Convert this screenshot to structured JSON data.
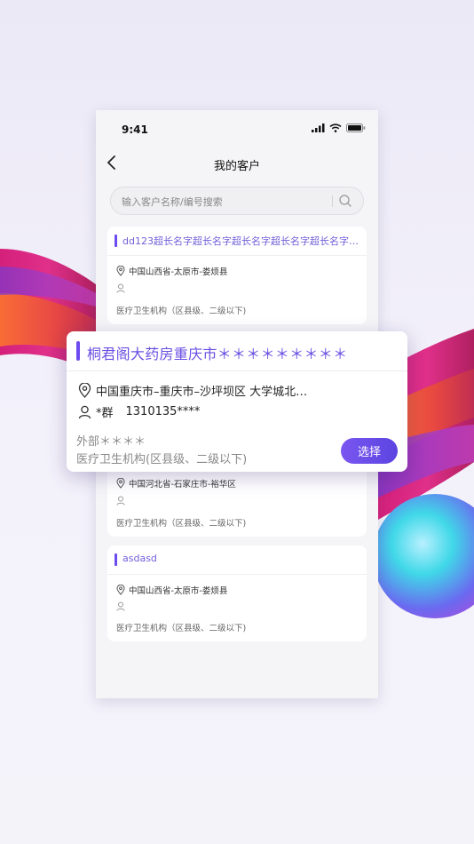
{
  "status_bar": {
    "time": "9:41"
  },
  "nav": {
    "title": "我的客户"
  },
  "search": {
    "placeholder": "输入客户名称/编号搜索"
  },
  "colors": {
    "accent": "#6c4cf0",
    "button_gradient_start": "#7a56f0",
    "button_gradient_end": "#5b44e0",
    "background": "#f5f5f7"
  },
  "icons": {
    "back": "chevron-left-icon",
    "search": "search-icon",
    "location": "location-pin-icon",
    "person": "person-icon",
    "signal": "signal-icon",
    "wifi": "wifi-icon",
    "battery": "battery-icon"
  },
  "cards": [
    {
      "name": "dd123超长名字超长名字超长名字超长名字超长名字…",
      "address": "中国山西省-太原市-娄烦县",
      "contact": "",
      "type": "医疗卫生机构（区县级、二级以下)"
    },
    {
      "name": "",
      "address": "中国河北省-石家庄市-裕华区",
      "contact": "",
      "type": "医疗卫生机构（区县级、二级以下)"
    },
    {
      "name": "asdasd",
      "address": "中国山西省-太原市-娄烦县",
      "contact": "",
      "type": "医疗卫生机构（区县级、二级以下)"
    }
  ],
  "popup": {
    "name": "桐君阁大药房重庆市＊＊＊＊＊＊＊＊＊",
    "address": "中国重庆市–重庆市–沙坪坝区 大学城北…",
    "contact_name": "*群",
    "contact_phone": "1310135****",
    "external": "外部＊＊＊＊",
    "type": "医疗卫生机构(区县级、二级以下)",
    "select_label": "选择"
  }
}
